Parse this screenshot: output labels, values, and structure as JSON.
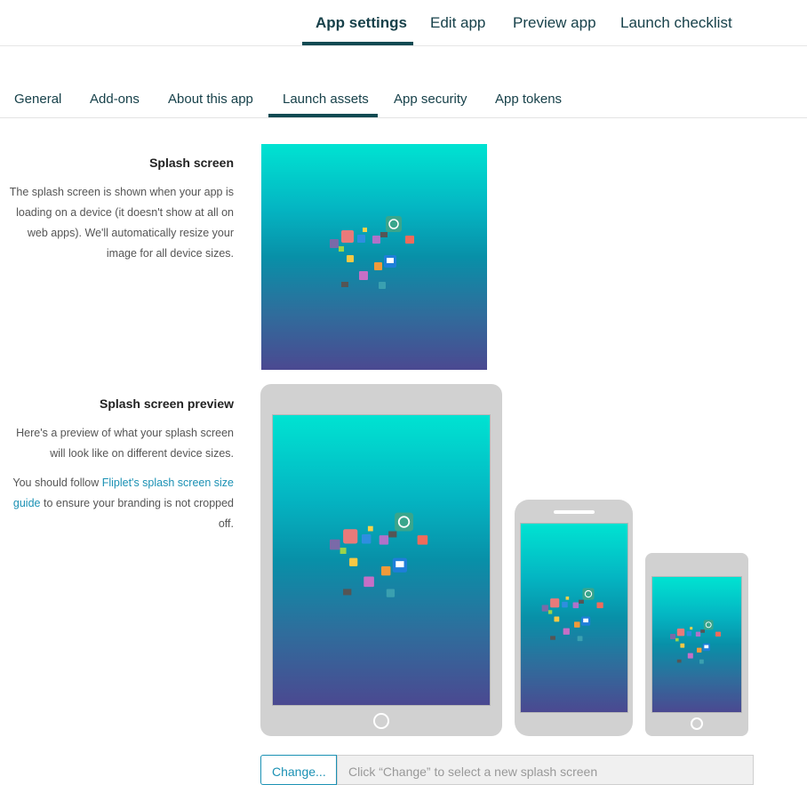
{
  "top_nav": {
    "items": [
      {
        "label": "App settings",
        "active": true
      },
      {
        "label": "Edit app"
      },
      {
        "label": "Preview app"
      },
      {
        "label": "Launch checklist"
      }
    ]
  },
  "sub_tabs": [
    {
      "label": "General"
    },
    {
      "label": "Add-ons"
    },
    {
      "label": "About this app"
    },
    {
      "label": "Launch assets",
      "active": true
    },
    {
      "label": "App security"
    },
    {
      "label": "App tokens"
    }
  ],
  "splash_section": {
    "title": "Splash screen",
    "description": "The splash screen is shown when your app is loading on a device (it doesn't show at all on web apps). We'll automatically resize your image for all device sizes."
  },
  "preview_section": {
    "title": "Splash screen preview",
    "description1": "Here's a preview of what your splash screen will look like on different device sizes.",
    "description2_prefix": "You should follow ",
    "link_text": "Fliplet's splash screen size guide",
    "description2_suffix": " to ensure your branding is not cropped off."
  },
  "controls": {
    "change_label": "Change...",
    "field_placeholder": "Click “Change” to select a new splash screen"
  },
  "colors": {
    "accent": "#0e4a52",
    "link": "#1b91b4",
    "gradient_top": "#00e3d2",
    "gradient_bottom": "#4b4991"
  }
}
